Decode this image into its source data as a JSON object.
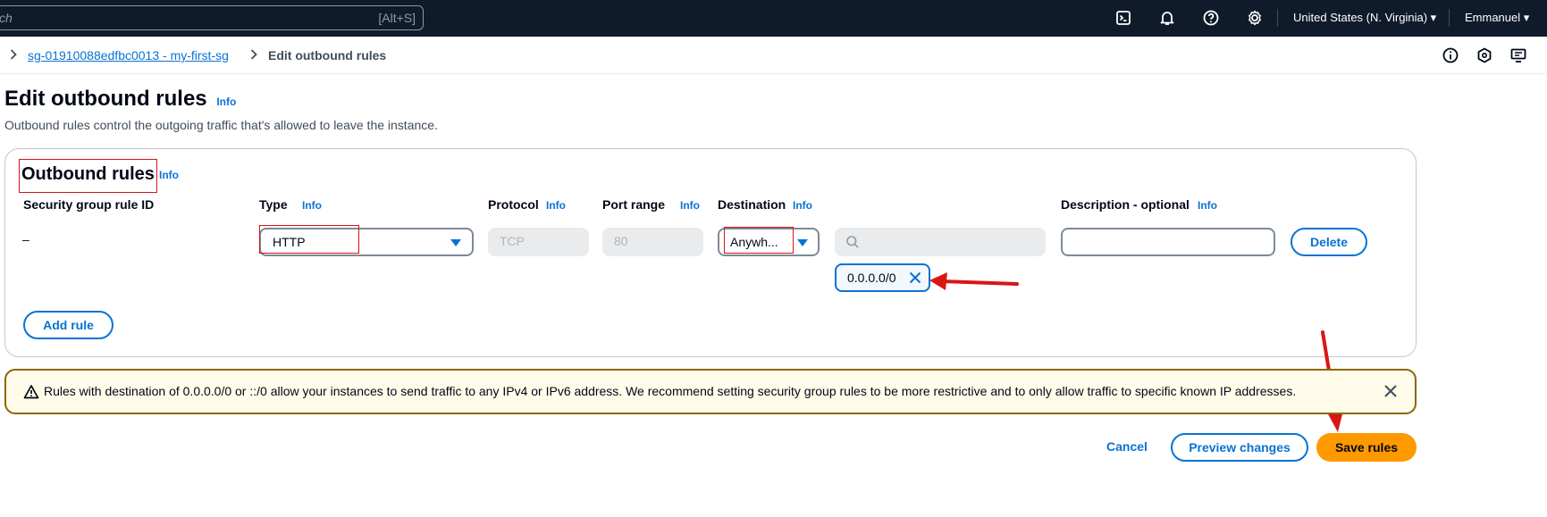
{
  "topnav": {
    "search_placeholder": "ch",
    "search_shortcut": "[Alt+S]",
    "region": "United States (N. Virginia)",
    "user": "Emmanuel"
  },
  "breadcrumb": {
    "parent": "sg-01910088edfbc0013 - my-first-sg",
    "current": "Edit outbound rules"
  },
  "page": {
    "title": "Edit outbound rules",
    "info": "Info",
    "description": "Outbound rules control the outgoing traffic that's allowed to leave the instance."
  },
  "rules_section": {
    "title": "Outbound rules",
    "info": "Info",
    "columns": {
      "rule_id": "Security group rule ID",
      "type": "Type",
      "protocol": "Protocol",
      "port_range": "Port range",
      "destination": "Destination",
      "description": "Description - optional"
    },
    "info_label": "Info",
    "row": {
      "rule_id": "–",
      "type": "HTTP",
      "protocol": "TCP",
      "port_range": "80",
      "destination": "Anywh...",
      "cidr_token": "0.0.0.0/0",
      "delete_label": "Delete"
    },
    "add_rule_label": "Add rule"
  },
  "warning": {
    "text": "Rules with destination of 0.0.0.0/0 or ::/0 allow your instances to send traffic to any IPv4 or IPv6 address. We recommend setting security group rules to be more restrictive and to only allow traffic to specific known IP addresses."
  },
  "actions": {
    "cancel": "Cancel",
    "preview": "Preview changes",
    "save": "Save rules"
  },
  "colors": {
    "nav_bg": "#0f1b2a",
    "link": "#0972d3",
    "primary": "#ff9900",
    "annotation": "#d91515",
    "warning_border": "#8d6605"
  }
}
